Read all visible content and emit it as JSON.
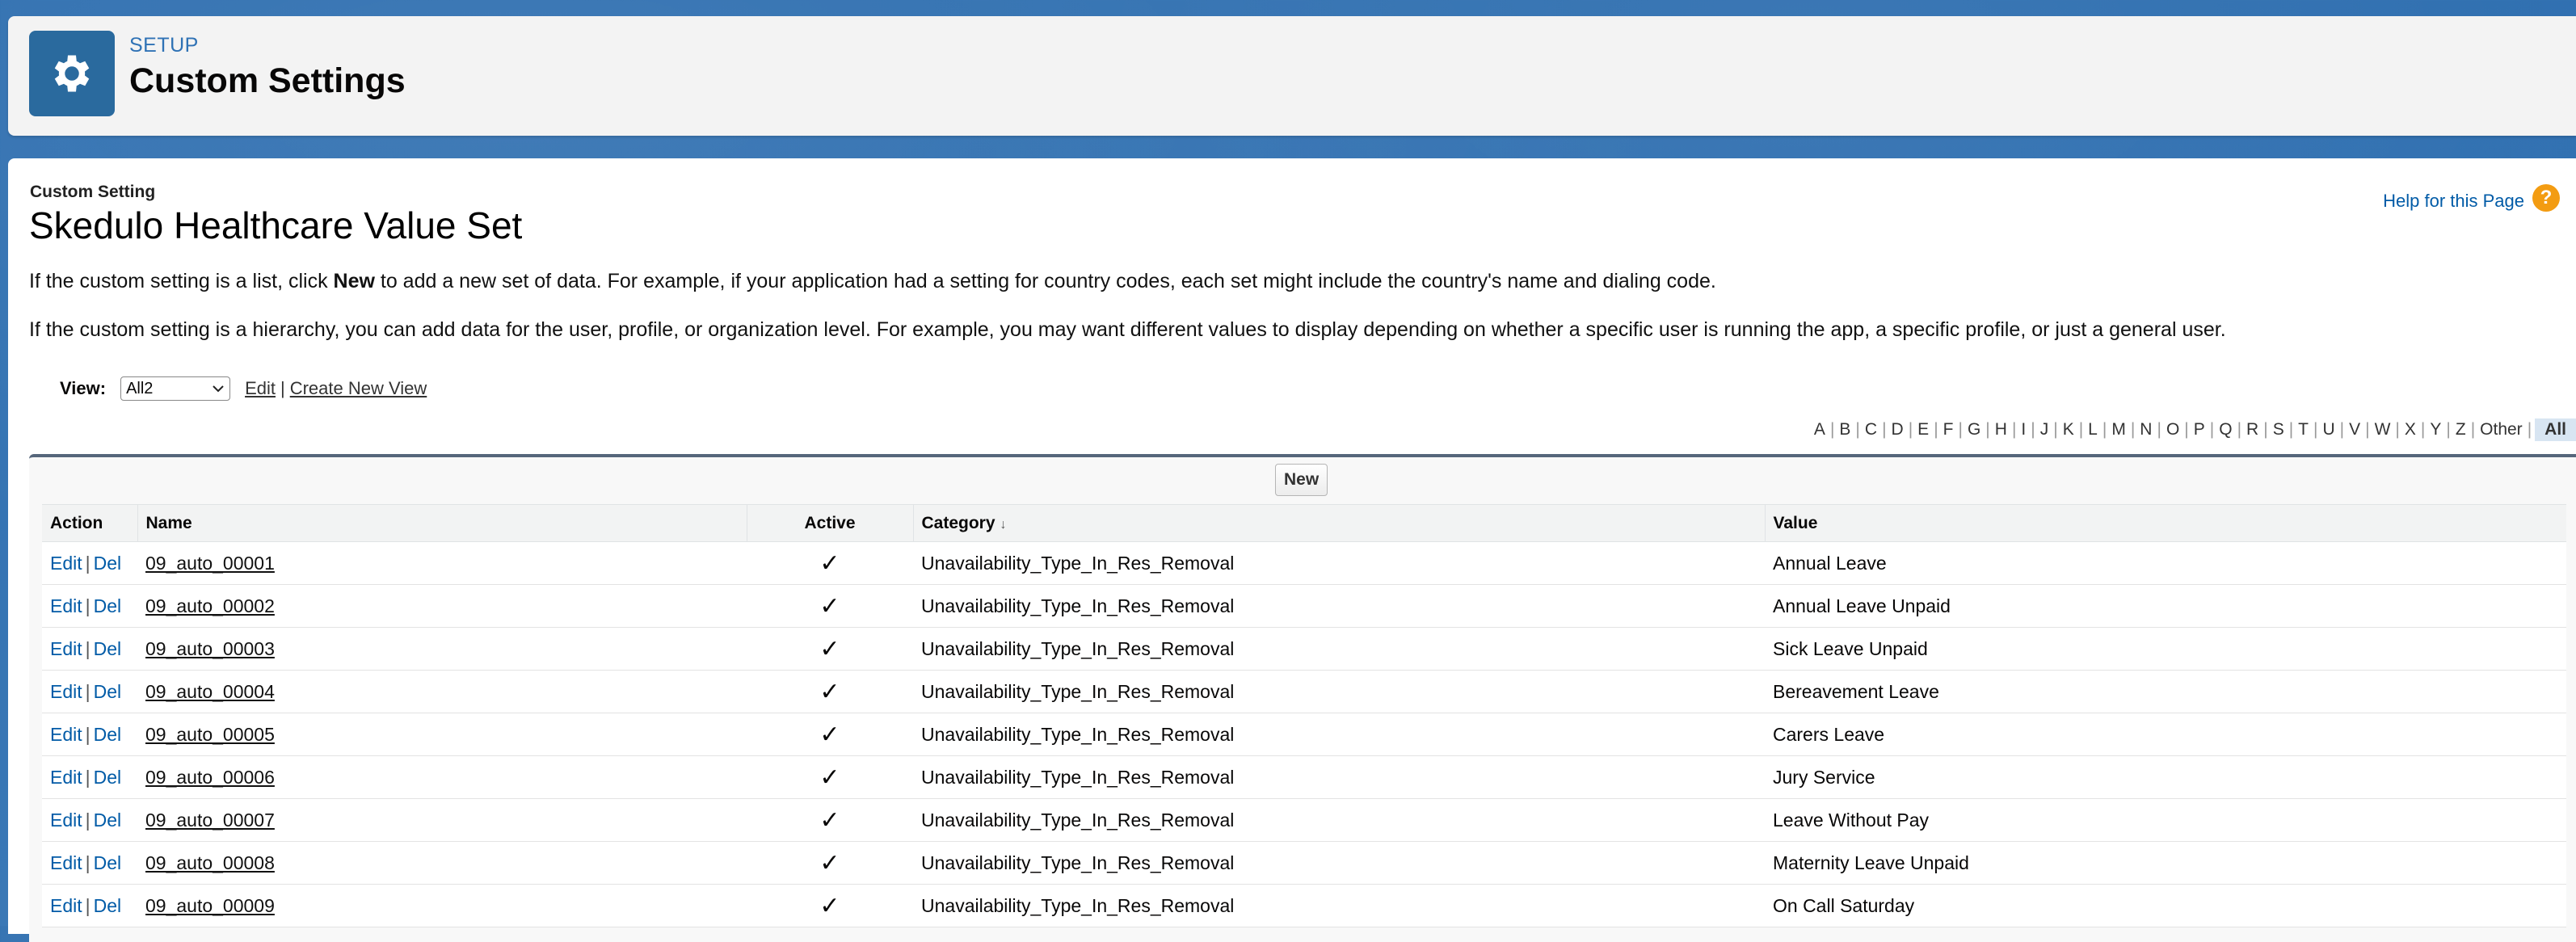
{
  "header": {
    "setup_label": "SETUP",
    "title": "Custom Settings"
  },
  "main": {
    "crumb": "Custom Setting",
    "title": "Skedulo Healthcare Value Set",
    "help_link": "Help for this Page",
    "para1_before": "If the custom setting is a list, click ",
    "para1_bold": "New",
    "para1_after": " to add a new set of data. For example, if your application had a setting for country codes, each set might include the country's name and dialing code.",
    "para2": "If the custom setting is a hierarchy, you can add data for the user, profile, or organization level. For example, you may want different values to display depending on whether a specific user is running the app, a specific profile, or just a general user."
  },
  "view": {
    "label": "View:",
    "selected": "All2",
    "edit": "Edit",
    "divider": "|",
    "create": "Create New View"
  },
  "alphabet": [
    "A",
    "B",
    "C",
    "D",
    "E",
    "F",
    "G",
    "H",
    "I",
    "J",
    "K",
    "L",
    "M",
    "N",
    "O",
    "P",
    "Q",
    "R",
    "S",
    "T",
    "U",
    "V",
    "W",
    "X",
    "Y",
    "Z",
    "Other",
    "All"
  ],
  "table": {
    "new_button": "New",
    "columns": {
      "action": "Action",
      "name": "Name",
      "active": "Active",
      "category": "Category",
      "value": "Value"
    },
    "edit_label": "Edit",
    "del_label": "Del",
    "rows": [
      {
        "name": "09_auto_00001",
        "active": "✓",
        "category": "Unavailability_Type_In_Res_Removal",
        "value": "Annual Leave"
      },
      {
        "name": "09_auto_00002",
        "active": "✓",
        "category": "Unavailability_Type_In_Res_Removal",
        "value": "Annual Leave Unpaid"
      },
      {
        "name": "09_auto_00003",
        "active": "✓",
        "category": "Unavailability_Type_In_Res_Removal",
        "value": "Sick Leave Unpaid"
      },
      {
        "name": "09_auto_00004",
        "active": "✓",
        "category": "Unavailability_Type_In_Res_Removal",
        "value": "Bereavement Leave"
      },
      {
        "name": "09_auto_00005",
        "active": "✓",
        "category": "Unavailability_Type_In_Res_Removal",
        "value": "Carers Leave"
      },
      {
        "name": "09_auto_00006",
        "active": "✓",
        "category": "Unavailability_Type_In_Res_Removal",
        "value": "Jury Service"
      },
      {
        "name": "09_auto_00007",
        "active": "✓",
        "category": "Unavailability_Type_In_Res_Removal",
        "value": "Leave Without Pay"
      },
      {
        "name": "09_auto_00008",
        "active": "✓",
        "category": "Unavailability_Type_In_Res_Removal",
        "value": "Maternity Leave Unpaid"
      },
      {
        "name": "09_auto_00009",
        "active": "✓",
        "category": "Unavailability_Type_In_Res_Removal",
        "value": "On Call Saturday"
      }
    ]
  }
}
